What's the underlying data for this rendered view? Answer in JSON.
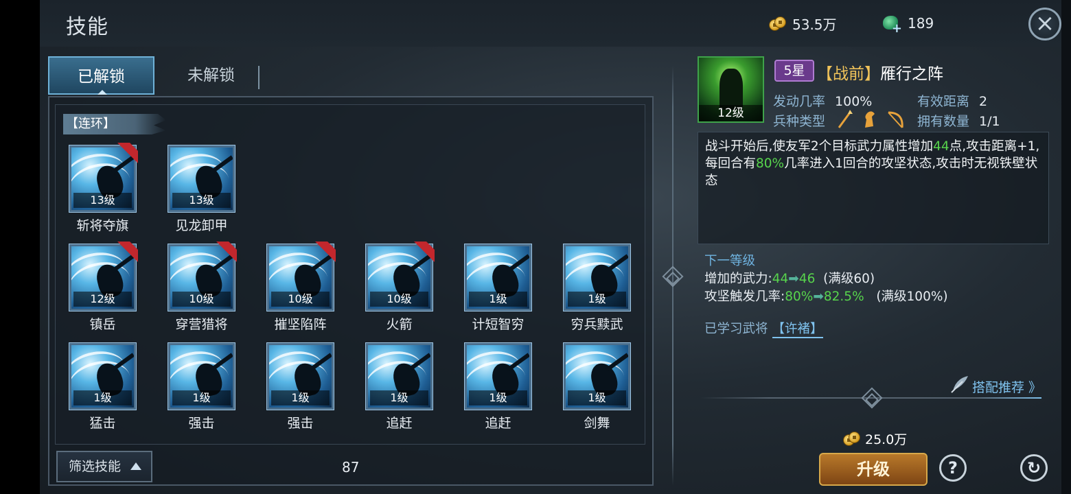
{
  "header": {
    "title": "技能",
    "gold": "53.5万",
    "jade": "189"
  },
  "tabs": [
    {
      "label": "已解锁",
      "active": true
    },
    {
      "label": "未解锁",
      "active": false
    }
  ],
  "category": "【连环】",
  "skills": [
    {
      "name": "斩将夺旗",
      "level": "13级",
      "learnable": true
    },
    {
      "name": "见龙卸甲",
      "level": "13级",
      "learnable": false
    },
    {
      "name": "镇岳",
      "level": "12级",
      "learnable": true
    },
    {
      "name": "穿营猎将",
      "level": "10级",
      "learnable": true
    },
    {
      "name": "摧坚陷阵",
      "level": "10级",
      "learnable": true
    },
    {
      "name": "火箭",
      "level": "10级",
      "learnable": true
    },
    {
      "name": "计短智穷",
      "level": "1级",
      "learnable": false
    },
    {
      "name": "穷兵黩武",
      "level": "1级",
      "learnable": false
    },
    {
      "name": "猛击",
      "level": "1级",
      "learnable": false
    },
    {
      "name": "强击",
      "level": "1级",
      "learnable": false
    },
    {
      "name": "强击",
      "level": "1级",
      "learnable": false
    },
    {
      "name": "追赶",
      "level": "1级",
      "learnable": false
    },
    {
      "name": "追赶",
      "level": "1级",
      "learnable": false
    },
    {
      "name": "剑舞",
      "level": "1级",
      "learnable": false
    }
  ],
  "filter": {
    "label": "筛选技能",
    "count": "87"
  },
  "detail": {
    "portrait_level": "12级",
    "star": "5星",
    "type_tag": "【战前】",
    "name": "雁行之阵",
    "trigger_rate_label": "发动几率",
    "trigger_rate": "100%",
    "range_label": "有效距离",
    "range": "2",
    "unit_type_label": "兵种类型",
    "owned_label": "拥有数量",
    "owned": "1/1",
    "description": {
      "p1": "战斗开始后,使友军2个目标武力属性增加",
      "v1": "44",
      "p2": "点,攻击距离+1,每回合有",
      "v2": "80%",
      "p3": "几率进入1回合的攻坚状态,攻击时无视铁壁状态"
    },
    "next_level_title": "下一等级",
    "next1_label": "增加的武力:",
    "next1_from": "44",
    "next1_to": "46",
    "next1_max": "(满级60)",
    "next2_label": "攻坚触发几率:",
    "next2_from": "80%",
    "next2_to": "82.5%",
    "next2_max": "(满级100%)",
    "learned_label": "已学习武将",
    "learned_hero": "【许褚】",
    "match_label": "搭配推荐 》",
    "cost": "25.0万",
    "upgrade_label": "升级"
  },
  "icons": [
    "close-icon",
    "coin-icon",
    "jade-icon",
    "help-icon",
    "refresh-icon",
    "feather-icon",
    "spear-icon",
    "horse-icon",
    "bow-icon"
  ],
  "colors": {
    "highlight_green": "#57d44c",
    "link_blue": "#7fc2ee",
    "upgrade_gold": "#b8792a",
    "star_purple": "#6a3a8c"
  }
}
